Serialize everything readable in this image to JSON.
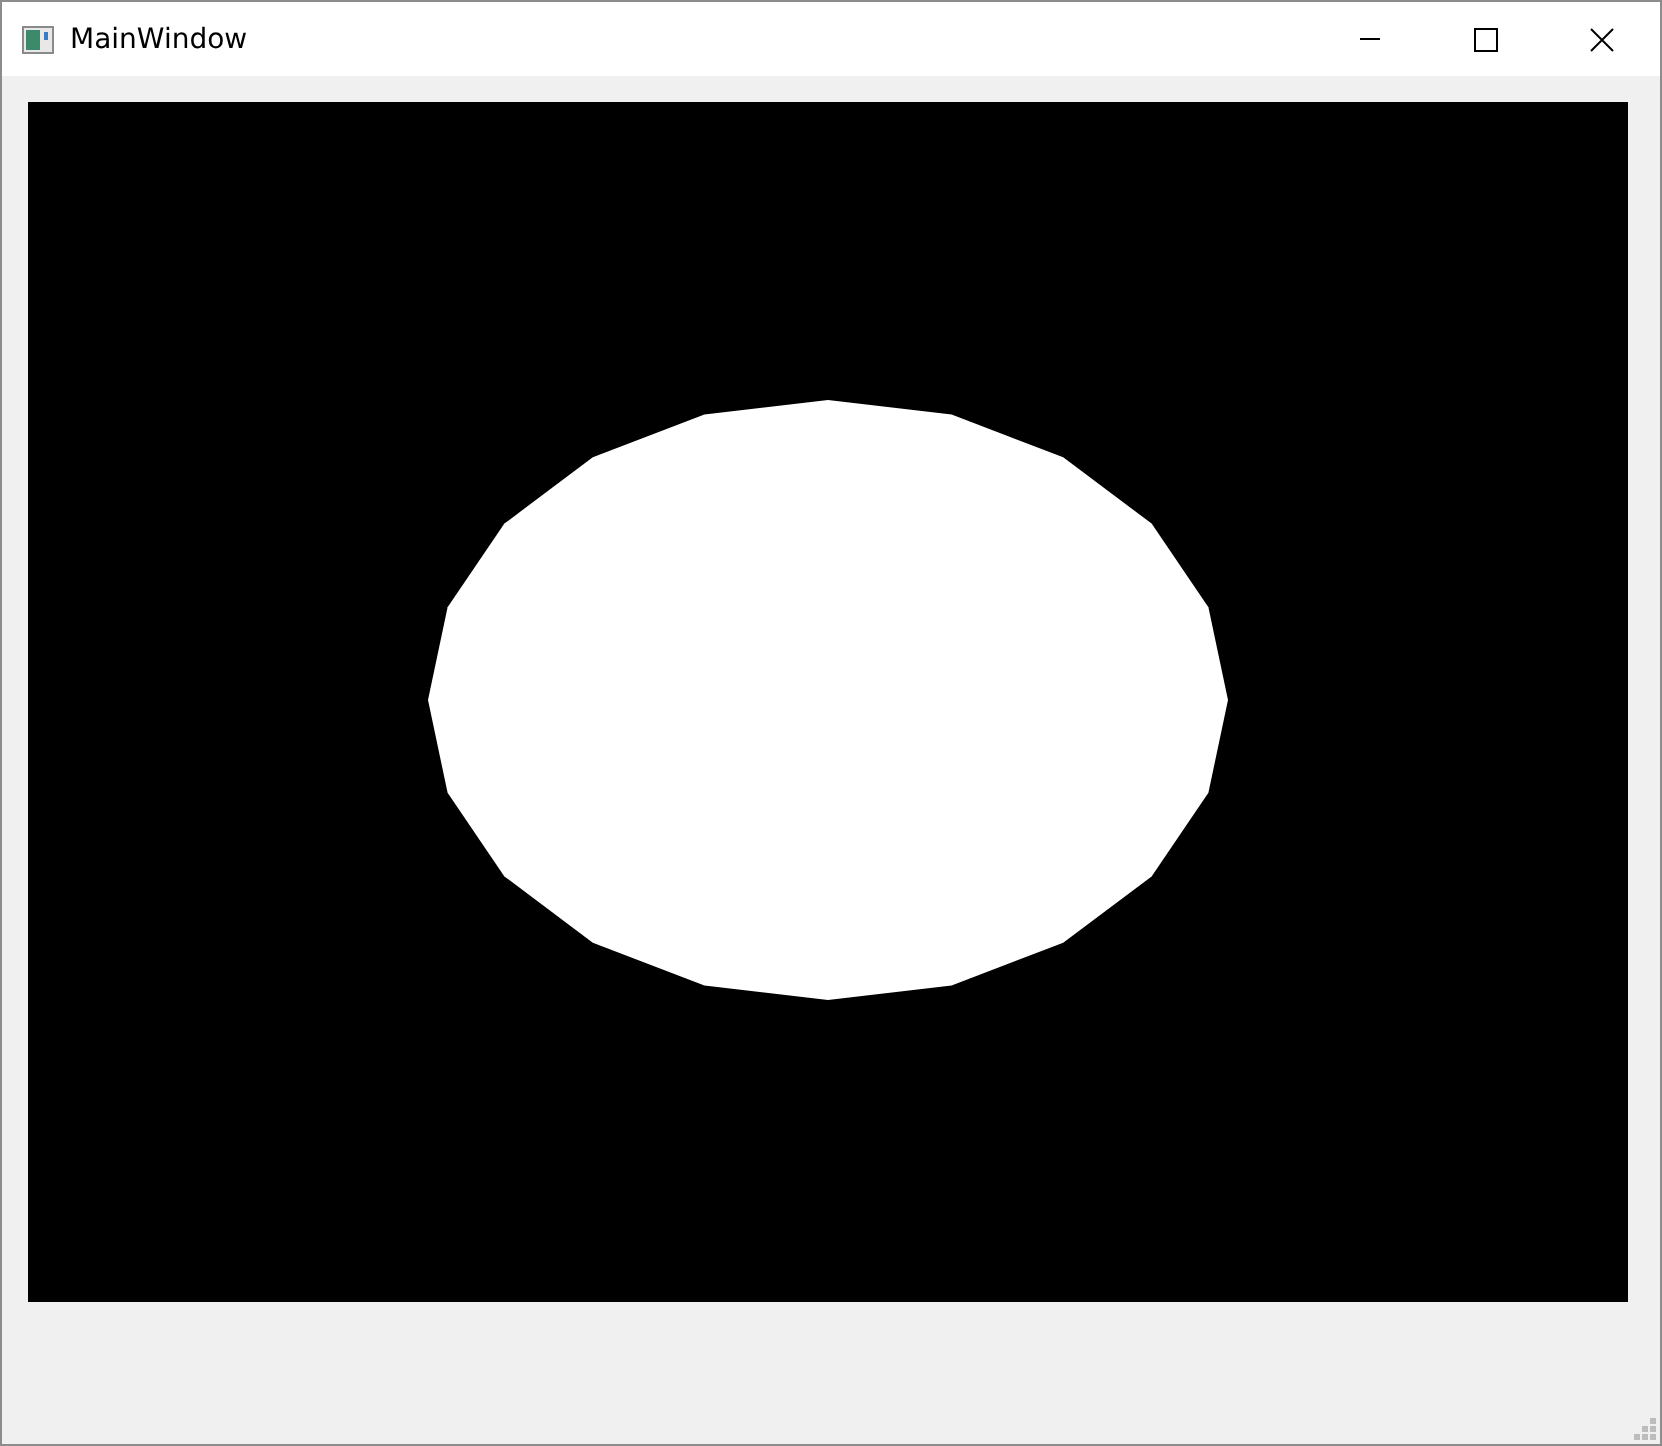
{
  "window": {
    "title": "MainWindow"
  }
}
